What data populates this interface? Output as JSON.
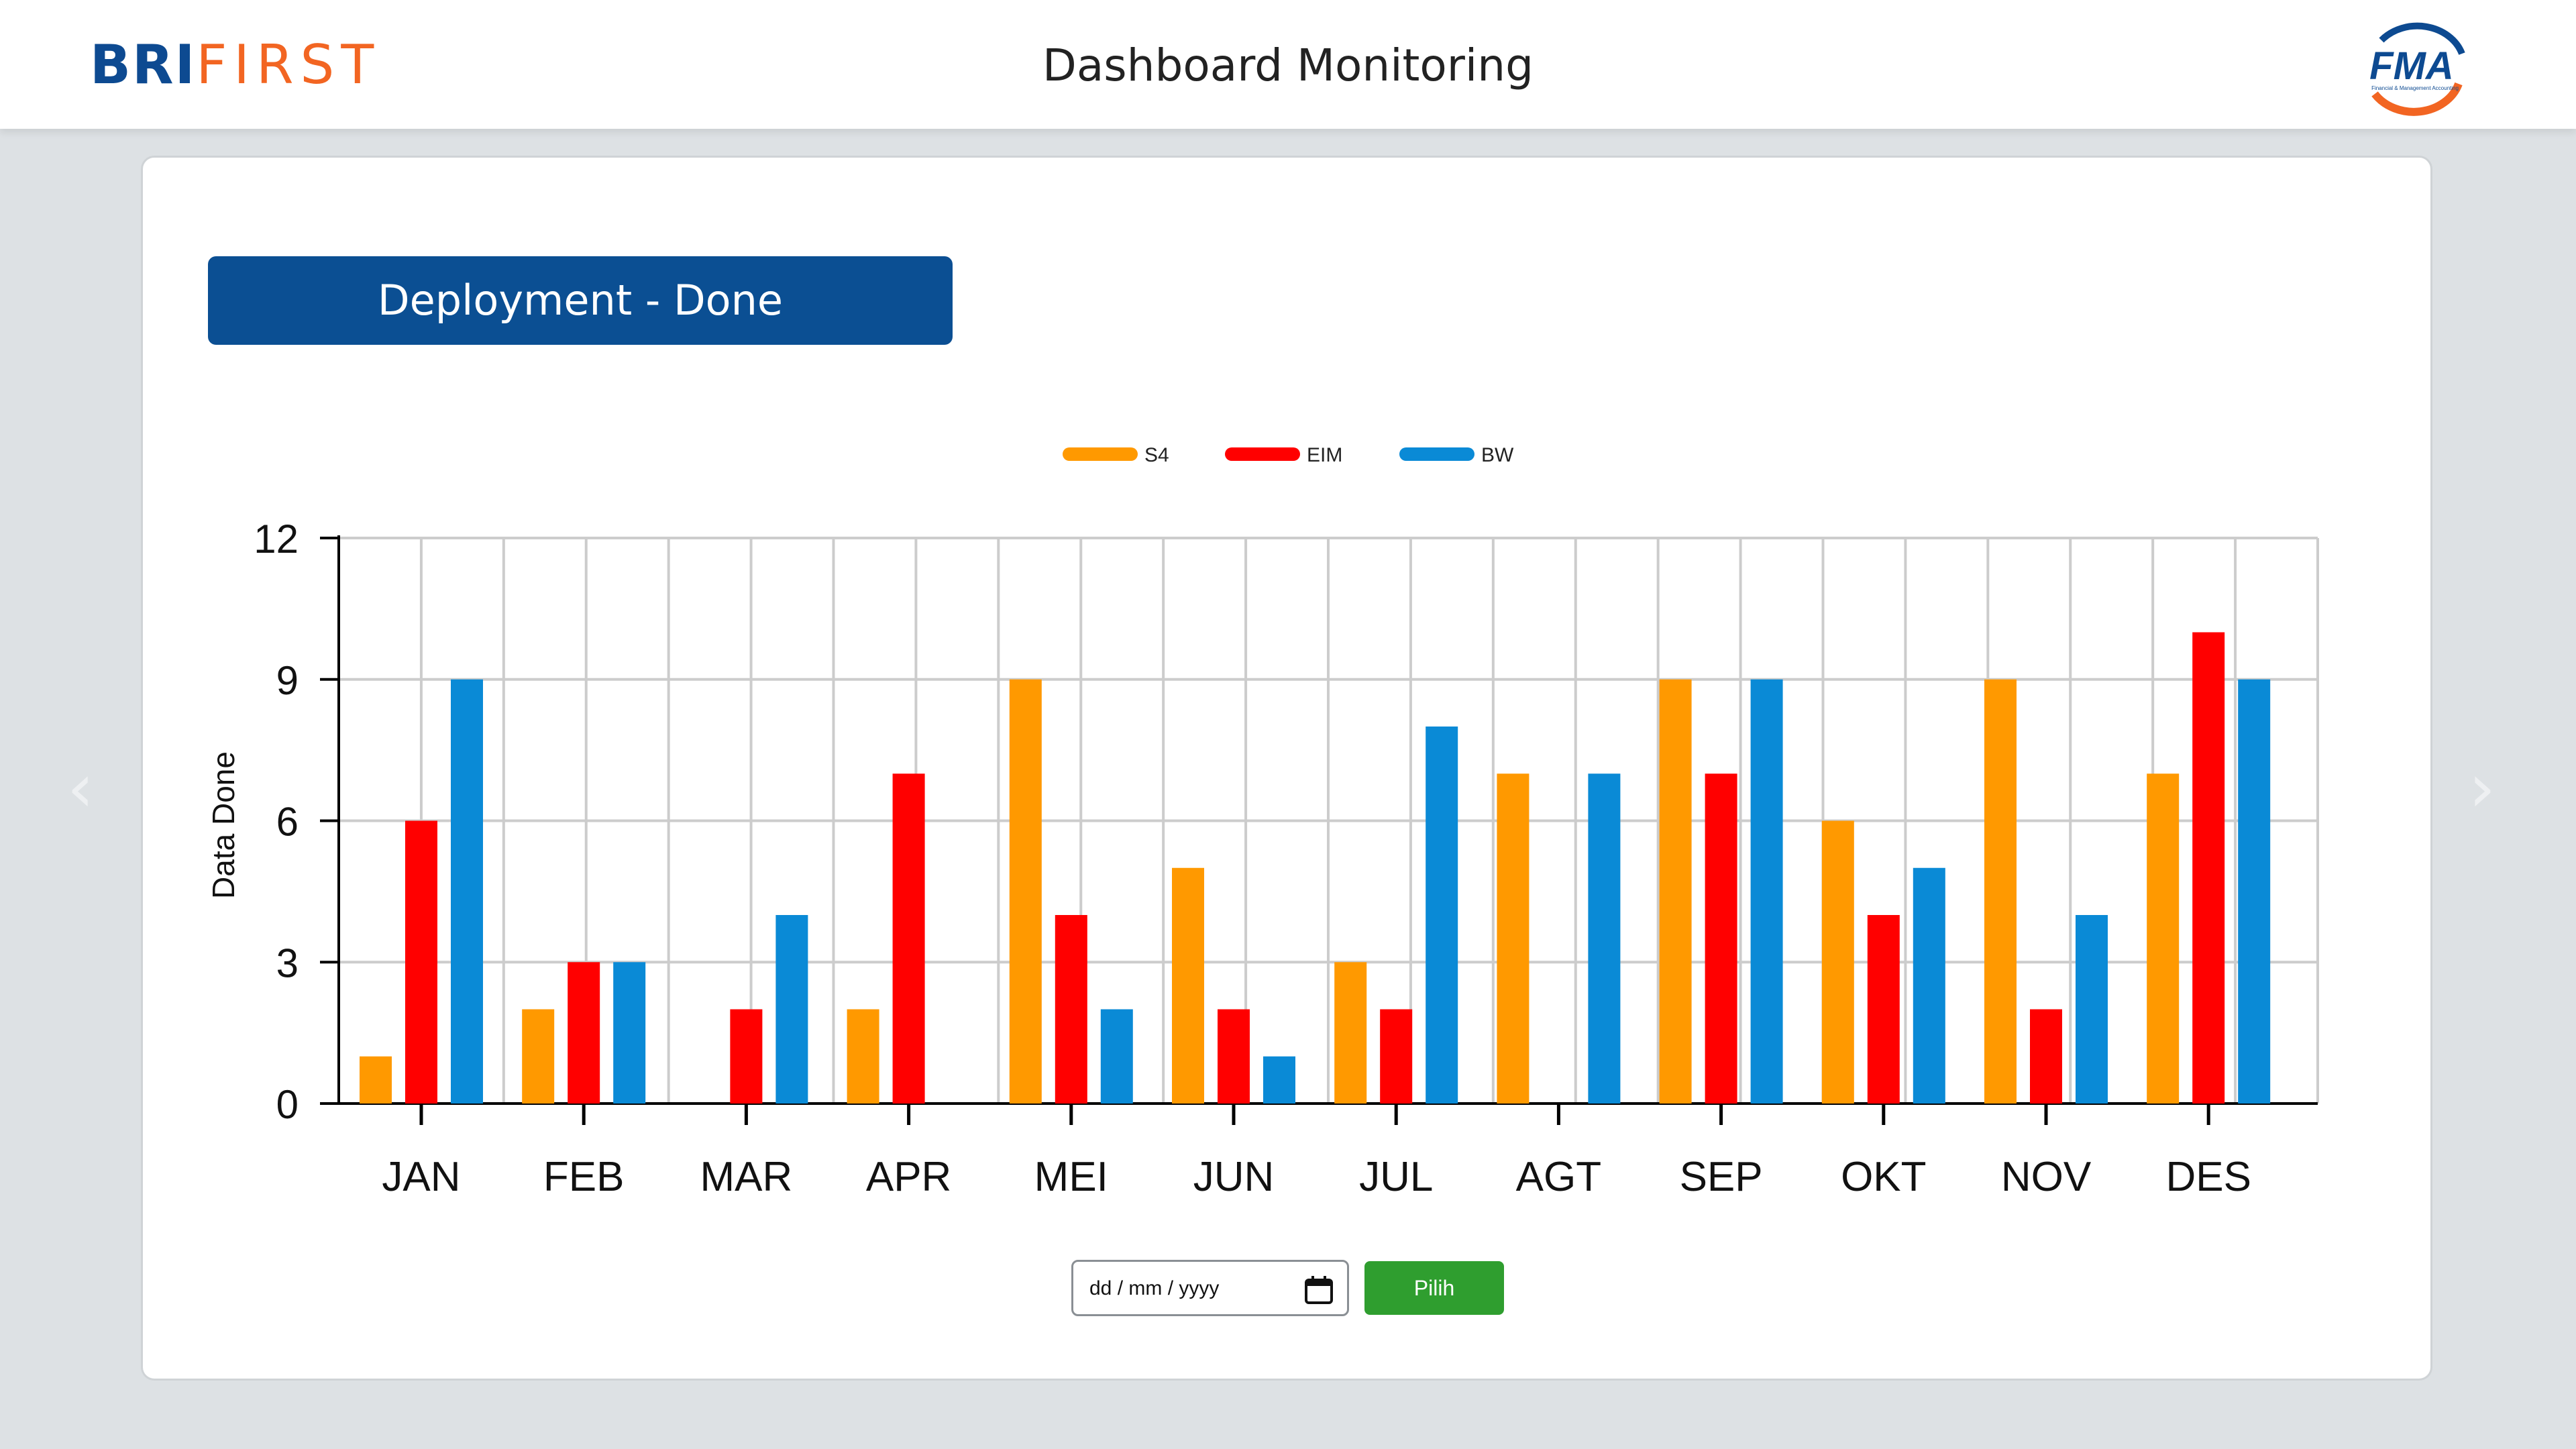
{
  "header": {
    "brand_left": "BRI",
    "brand_right": "FIRST",
    "title": "Dashboard Monitoring",
    "logo_text": "FMA",
    "logo_subtext": "Financial & Management Accounting"
  },
  "section": {
    "badge": "Deployment - Done"
  },
  "nav": {
    "prev": "‹",
    "next": "›"
  },
  "filter": {
    "date_placeholder": "dd / mm / yyyy",
    "button_label": "Pilih"
  },
  "colors": {
    "S4": "#ff9900",
    "EIM": "#ff0000",
    "BW": "#0a8ad6",
    "brand_blue": "#0b4f93",
    "button_green": "#2f9e2f"
  },
  "chart_data": {
    "type": "bar",
    "categories": [
      "JAN",
      "FEB",
      "MAR",
      "APR",
      "MEI",
      "JUN",
      "JUL",
      "AGT",
      "SEP",
      "OKT",
      "NOV",
      "DES"
    ],
    "series": [
      {
        "name": "S4",
        "values": [
          1,
          2,
          0,
          2,
          9,
          5,
          3,
          7,
          9,
          6,
          9,
          7
        ]
      },
      {
        "name": "EIM",
        "values": [
          6,
          3,
          2,
          7,
          4,
          2,
          2,
          0,
          7,
          4,
          2,
          10
        ]
      },
      {
        "name": "BW",
        "values": [
          9,
          3,
          4,
          0,
          2,
          1,
          8,
          7,
          9,
          5,
          4,
          9
        ]
      }
    ],
    "title": "",
    "xlabel": "",
    "ylabel": "Data Done",
    "ylim": [
      0,
      12
    ],
    "yticks": [
      0,
      3,
      6,
      9,
      12
    ],
    "grid": true,
    "legend": "top-center"
  }
}
